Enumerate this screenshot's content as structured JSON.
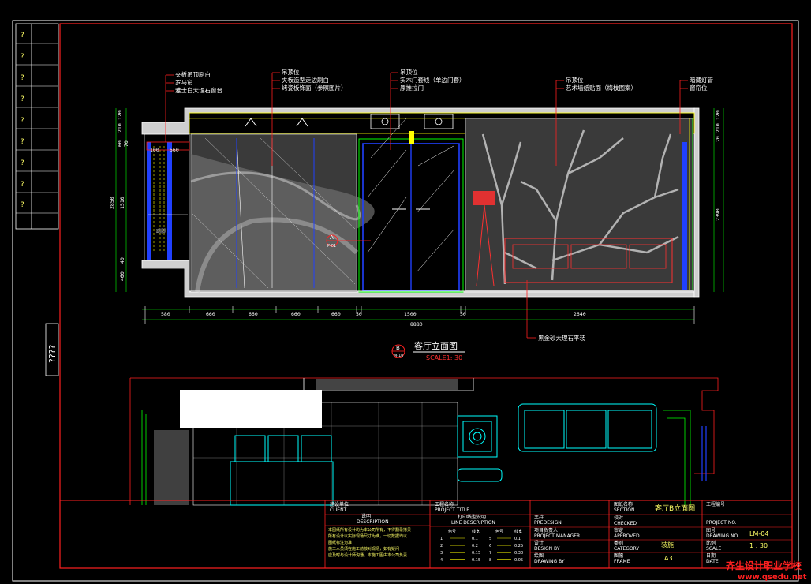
{
  "sidebar": {
    "marks": [
      "?",
      "?",
      "?",
      "?",
      "?",
      "?",
      "?",
      "?",
      "?"
    ],
    "vertical_text": "????"
  },
  "callouts": {
    "group1": [
      "夹板吊顶刷白",
      "罗马帘",
      "雅士白大理石窗台"
    ],
    "group2": [
      "吊顶位",
      "夹板造型走边刷白",
      "烤瓷板饰面（参照图片）"
    ],
    "group3": [
      "吊顶位",
      "实木门套线（单边门套）",
      "原推拉门"
    ],
    "group4": [
      "吊顶位",
      "艺术墙纸贴面（梅枝图案）"
    ],
    "group5": [
      "暗藏灯管",
      "窗帘位"
    ],
    "bottom": "黑金砂大理石平装"
  },
  "dims": {
    "bottom_row": [
      "580",
      "660",
      "660",
      "660",
      "660",
      "50",
      "1500",
      "50",
      "2640"
    ],
    "total": "8880",
    "left": [
      "120",
      "210",
      "60",
      "70",
      "100",
      "2850",
      "1510",
      "40",
      "460"
    ],
    "right": [
      "120",
      "210",
      "20",
      "2390"
    ],
    "small_top": [
      "100",
      "560"
    ]
  },
  "markers": {
    "a_letter": "A",
    "a_ref": "P-01",
    "b_letter": "B",
    "b_ref": "M-10"
  },
  "elevation": {
    "title": "客厅立面图",
    "scale": "SCALE1: 30",
    "floor_word": "踢脚"
  },
  "titleblock": {
    "client_cn": "建设单位",
    "client_en": "CLIENT",
    "remark_cn": "说明",
    "remark_en": "DESCRIPTION",
    "remark_lines": [
      "本图纸所有设计均为本公司所有，不得翻录拷贝",
      "所有设计以实际现场尺寸为准，一切数据均以",
      "图纸标注为准",
      "施工人员须在施工前核对现场，如有疑问",
      "应及时与设计师沟通。本施工图由本公司负责"
    ],
    "project_cn": "工程名称",
    "project_en": "PROJECT TITLE",
    "line_cn": "打印线型说明",
    "line_en": "LINE DESCRIPTION",
    "line_header": [
      "色号",
      "线宽",
      "色号",
      "线宽"
    ],
    "line_rows": [
      [
        "1",
        "0.1",
        "5",
        "0.1"
      ],
      [
        "2",
        "0.2",
        "6",
        "0.25"
      ],
      [
        "3",
        "0.15",
        "7",
        "0.30"
      ],
      [
        "4",
        "0.15",
        "8",
        "0.05"
      ]
    ],
    "designer_cn": "主持",
    "designer_en": "PREDESIGN",
    "manager_cn": "项目负责人",
    "manager_en": "PROJECT MANAGER",
    "design_cn": "设计",
    "design_en": "DESIGN BY",
    "draw_cn": "绘图",
    "draw_en": "DRAWING BY",
    "section_cn": "图纸名称",
    "section_en": "SECTION",
    "section_value": "客厅B立面图",
    "check_cn": "校对",
    "check_en": "CHECKED",
    "approve_cn": "审定",
    "approve_en": "APPROVED",
    "category_cn": "类别",
    "category_en": "CATEGORY",
    "category_value": "装施",
    "frame_cn": "图幅",
    "frame_en": "FRAME",
    "frame_value": "A3",
    "projno_cn": "工程编号",
    "projno_en": "PROJECT NO.",
    "drawno_cn": "图号",
    "drawno_en": "DRAWING NO.",
    "drawno_value": "LM-04",
    "scale_cn": "比例",
    "scale_en": "SCALE",
    "scale_value": "1 : 30",
    "date_cn": "日期",
    "date_en": "DATE"
  },
  "watermark": {
    "cn": "齐生设计职业学校",
    "url": "www.qsedu.net"
  },
  "colors": {
    "frame_red": "#ff2020",
    "wall_white": "#ffffff",
    "cad_yellow": "#ffff00",
    "cad_blue": "#2040ff",
    "cad_green": "#00ff00",
    "cad_cyan": "#00ffff",
    "cad_magenta": "#ff00ff",
    "cad_grey": "#9a9a9a"
  }
}
